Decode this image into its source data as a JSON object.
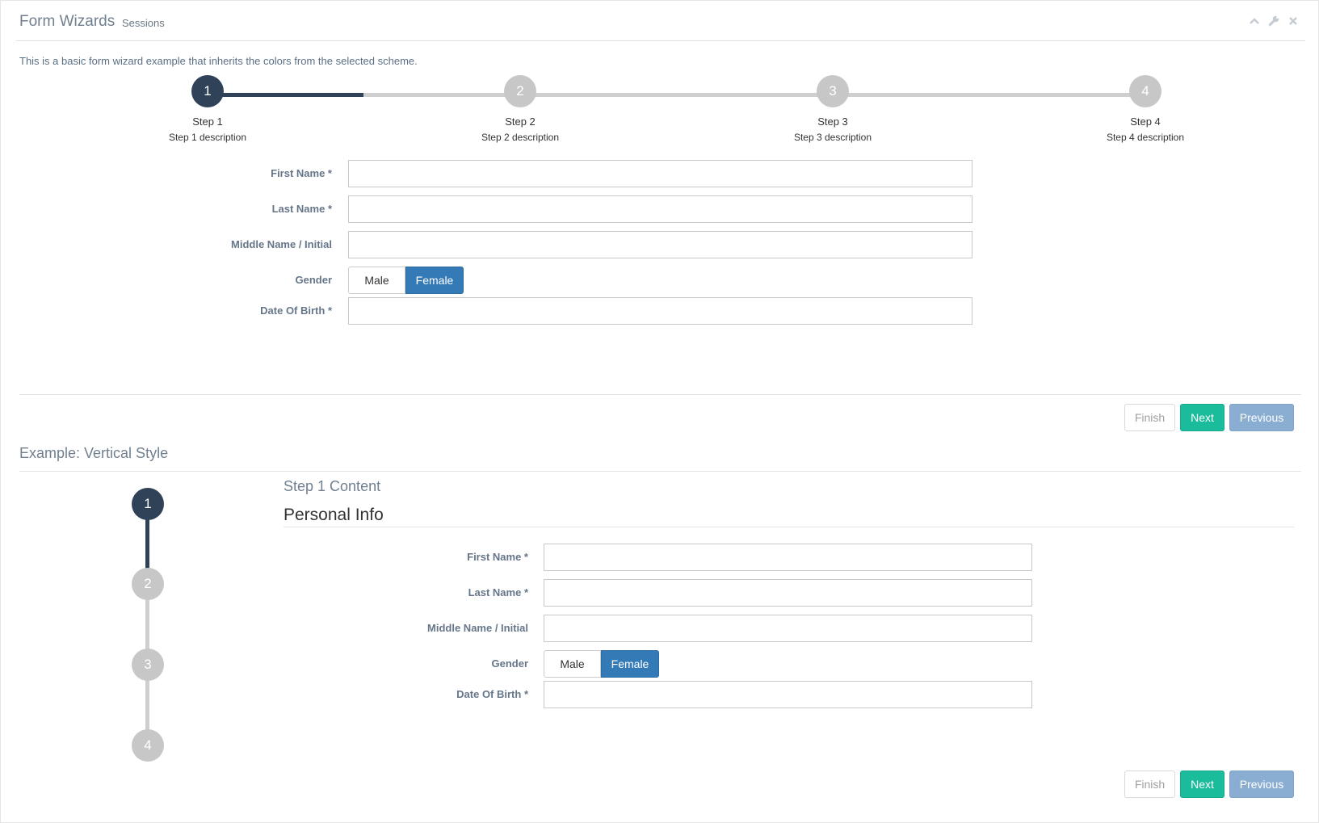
{
  "header": {
    "title": "Form Wizards",
    "subtitle": "Sessions",
    "tools": [
      "chevron-up-icon",
      "wrench-icon",
      "close-icon"
    ]
  },
  "intro": "This is a basic form wizard example that inherits the colors from the selected scheme.",
  "horizontal_wizard": {
    "current_step": 1,
    "steps": [
      {
        "number": "1",
        "title": "Step 1",
        "description": "Step 1 description"
      },
      {
        "number": "2",
        "title": "Step 2",
        "description": "Step 2 description"
      },
      {
        "number": "3",
        "title": "Step 3",
        "description": "Step 3 description"
      },
      {
        "number": "4",
        "title": "Step 4",
        "description": "Step 4 description"
      }
    ],
    "form": {
      "first_name_label": "First Name *",
      "last_name_label": "Last Name *",
      "middle_name_label": "Middle Name / Initial",
      "gender_label": "Gender",
      "gender_options": [
        "Male",
        "Female"
      ],
      "gender_selected": "Female",
      "dob_label": "Date Of Birth *",
      "first_name_value": "",
      "last_name_value": "",
      "middle_name_value": "",
      "dob_value": ""
    },
    "actions": {
      "finish": "Finish",
      "next": "Next",
      "previous": "Previous"
    }
  },
  "vertical_wizard": {
    "section_title": "Example: Vertical Style",
    "current_step": 1,
    "steps": [
      "1",
      "2",
      "3",
      "4"
    ],
    "content_kicker": "Step 1 Content",
    "content_heading": "Personal Info",
    "form": {
      "first_name_label": "First Name *",
      "last_name_label": "Last Name *",
      "middle_name_label": "Middle Name / Initial",
      "gender_label": "Gender",
      "gender_options": [
        "Male",
        "Female"
      ],
      "gender_selected": "Female",
      "dob_label": "Date Of Birth *",
      "first_name_value": "",
      "last_name_value": "",
      "middle_name_value": "",
      "dob_value": ""
    },
    "actions": {
      "finish": "Finish",
      "next": "Next",
      "previous": "Previous"
    }
  },
  "colors": {
    "active_step": "#2f4258",
    "inactive_step": "#c7c7c7",
    "next_button": "#1abc9c",
    "previous_button": "#8aaed2",
    "selected_toggle": "#337ab7"
  }
}
